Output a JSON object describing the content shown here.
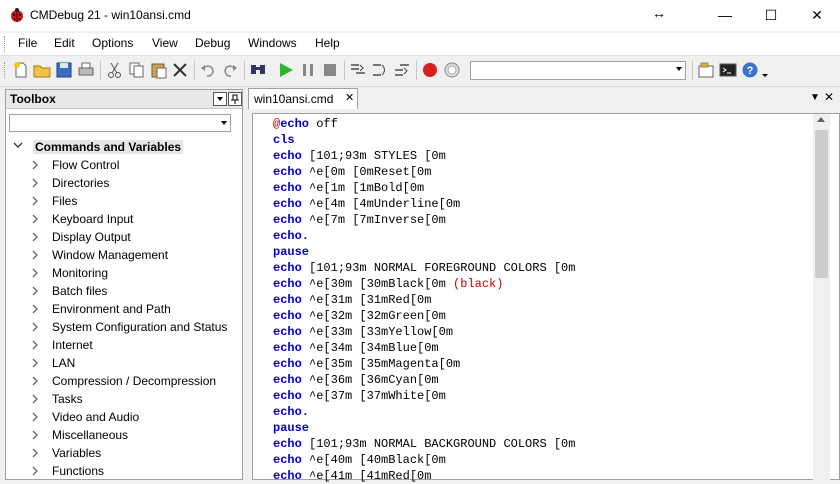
{
  "window": {
    "title": "CMDebug 21 - win10ansi.cmd",
    "resize_glyph": "↔",
    "minimize": "—",
    "maximize": "☐",
    "close": "✕"
  },
  "menu": [
    "File",
    "Edit",
    "Options",
    "View",
    "Debug",
    "Windows",
    "Help"
  ],
  "toolbar": {
    "icons": [
      "new-file-icon",
      "open-folder-icon",
      "save-icon",
      "print-icon",
      "cut-icon",
      "copy-icon",
      "paste-icon",
      "delete-icon",
      "undo-icon",
      "redo-icon",
      "find-icon",
      "run-icon",
      "pause-icon",
      "stop-icon",
      "step-into-icon",
      "step-over-icon",
      "step-out-icon",
      "record-icon",
      "breakpoint-clear-icon",
      "properties-icon",
      "console-icon",
      "help-icon"
    ],
    "combo_value": ""
  },
  "toolbox": {
    "title": "Toolbox",
    "filter_value": "",
    "category": {
      "label": "Commands and Variables",
      "expanded_glyph": "⌄"
    },
    "items": [
      "Flow Control",
      "Directories",
      "Files",
      "Keyboard Input",
      "Display Output",
      "Window Management",
      "Monitoring",
      "Batch files",
      "Environment and Path",
      "System Configuration and Status",
      "Internet",
      "LAN",
      "Compression / Decompression",
      "Tasks",
      "Video and Audio",
      "Miscellaneous",
      "Variables",
      "Functions"
    ]
  },
  "tabs": [
    {
      "label": "win10ansi.cmd",
      "close": "✕"
    }
  ],
  "tabstrip": {
    "dropdown": "▼",
    "close": "✕"
  },
  "editor": {
    "lines": [
      {
        "at": "@",
        "kw": "echo",
        "rest": " off"
      },
      {
        "kw": "cls",
        "rest": ""
      },
      {
        "kw": "echo",
        "rest": " [101;93m STYLES [0m"
      },
      {
        "kw": "echo",
        "rest": " ^e[0m [0mReset[0m"
      },
      {
        "kw": "echo",
        "rest": " ^e[1m [1mBold[0m"
      },
      {
        "kw": "echo",
        "rest": " ^e[4m [4mUnderline[0m"
      },
      {
        "kw": "echo",
        "rest": " ^e[7m [7mInverse[0m"
      },
      {
        "kw": "echo.",
        "rest": ""
      },
      {
        "kw": "pause",
        "rest": ""
      },
      {
        "kw": "echo",
        "rest": " [101;93m NORMAL FOREGROUND COLORS [0m"
      },
      {
        "kw": "echo",
        "rest": " ^e[30m [30mBlack[0m ",
        "paren": "(black)"
      },
      {
        "kw": "echo",
        "rest": " ^e[31m [31mRed[0m"
      },
      {
        "kw": "echo",
        "rest": " ^e[32m [32mGreen[0m"
      },
      {
        "kw": "echo",
        "rest": " ^e[33m [33mYellow[0m"
      },
      {
        "kw": "echo",
        "rest": " ^e[34m [34mBlue[0m"
      },
      {
        "kw": "echo",
        "rest": " ^e[35m [35mMagenta[0m"
      },
      {
        "kw": "echo",
        "rest": " ^e[36m [36mCyan[0m"
      },
      {
        "kw": "echo",
        "rest": " ^e[37m [37mWhite[0m"
      },
      {
        "kw": "echo.",
        "rest": ""
      },
      {
        "kw": "pause",
        "rest": ""
      },
      {
        "kw": "echo",
        "rest": " [101;93m NORMAL BACKGROUND COLORS [0m"
      },
      {
        "kw": "echo",
        "rest": " ^e[40m [40mBlack[0m"
      },
      {
        "kw": "echo",
        "rest": " ^e[41m [41mRed[0m"
      }
    ]
  },
  "colors": {
    "keyword": "#0000c8",
    "at_sign": "#c00000",
    "run_green": "#2db52d",
    "record_red": "#d42020"
  }
}
